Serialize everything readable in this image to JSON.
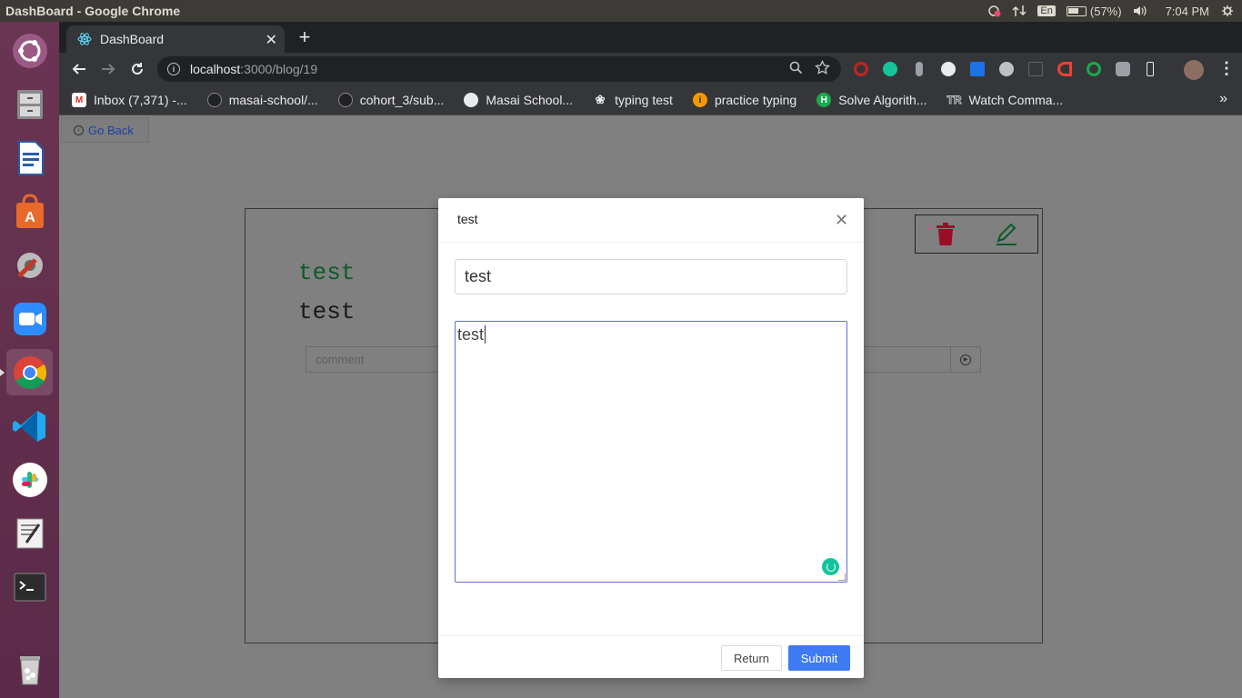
{
  "os": {
    "window_title": "DashBoard - Google Chrome",
    "language_indicator": "En",
    "battery_text": "(57%)",
    "clock": "7:04 PM"
  },
  "browser": {
    "tab_title": "DashBoard",
    "url_host": "localhost",
    "url_path": ":3000/blog/19",
    "bookmarks": [
      {
        "label": "Inbox (7,371) -...",
        "icon": "gmail-icon",
        "color": "#d93025"
      },
      {
        "label": "masai-school/...",
        "icon": "github-icon",
        "color": "#202124"
      },
      {
        "label": "cohort_3/sub...",
        "icon": "github-icon",
        "color": "#202124"
      },
      {
        "label": "Masai School...",
        "icon": "globe-icon",
        "color": "#e8eaed"
      },
      {
        "label": "typing test",
        "icon": "paw-icon",
        "color": "#202124"
      },
      {
        "label": "practice typing",
        "icon": "typing-icon",
        "color": "#f29900"
      },
      {
        "label": "Solve Algorith...",
        "icon": "hackerrank-icon",
        "color": "#1ba94c"
      },
      {
        "label": "Watch Comma...",
        "icon": "tr-icon",
        "color": "#202124"
      }
    ]
  },
  "page": {
    "go_back_label": "Go Back",
    "blog_title": "test",
    "blog_body": "test",
    "comment_placeholder": "comment"
  },
  "modal": {
    "title": "test",
    "title_input_value": "test",
    "body_value": "test",
    "return_label": "Return",
    "submit_label": "Submit"
  },
  "colors": {
    "accent": "#3f7af5",
    "delete_icon": "#c8102e",
    "edit_icon": "#1a7f3c",
    "title_green": "#0e5a2a"
  }
}
